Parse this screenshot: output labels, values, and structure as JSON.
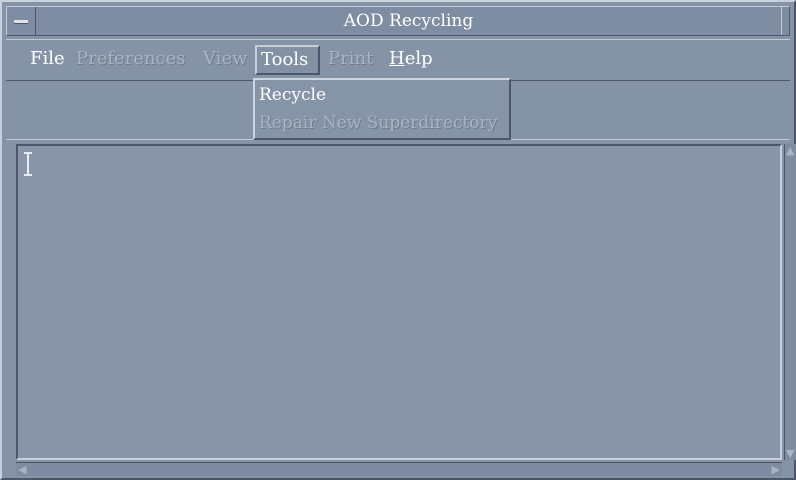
{
  "window": {
    "title": "AOD Recycling"
  },
  "menubar": {
    "items": [
      {
        "label": "File",
        "state": "enabled"
      },
      {
        "label": "Preferences",
        "state": "disabled"
      },
      {
        "label": "View",
        "state": "disabled"
      },
      {
        "label": "Tools",
        "state": "open"
      },
      {
        "label": "Print",
        "state": "disabled"
      },
      {
        "label": "Help",
        "mnemonic": "H",
        "state": "enabled"
      }
    ]
  },
  "tools_menu": {
    "items": [
      {
        "label": "Recycle",
        "state": "enabled"
      },
      {
        "label": "Repair New Superdirectory",
        "state": "disabled"
      }
    ]
  },
  "icons": {
    "window_menu": "window-menu-icon",
    "text_cursor": "i-beam-cursor-icon",
    "scroll_up": "arrow-up-icon",
    "scroll_down": "arrow-down-icon",
    "scroll_left": "arrow-left-icon",
    "scroll_right": "arrow-right-icon"
  },
  "colors": {
    "background": "#8593a6",
    "text": "#ffffff",
    "disabled_text": "#a9b3c2"
  }
}
